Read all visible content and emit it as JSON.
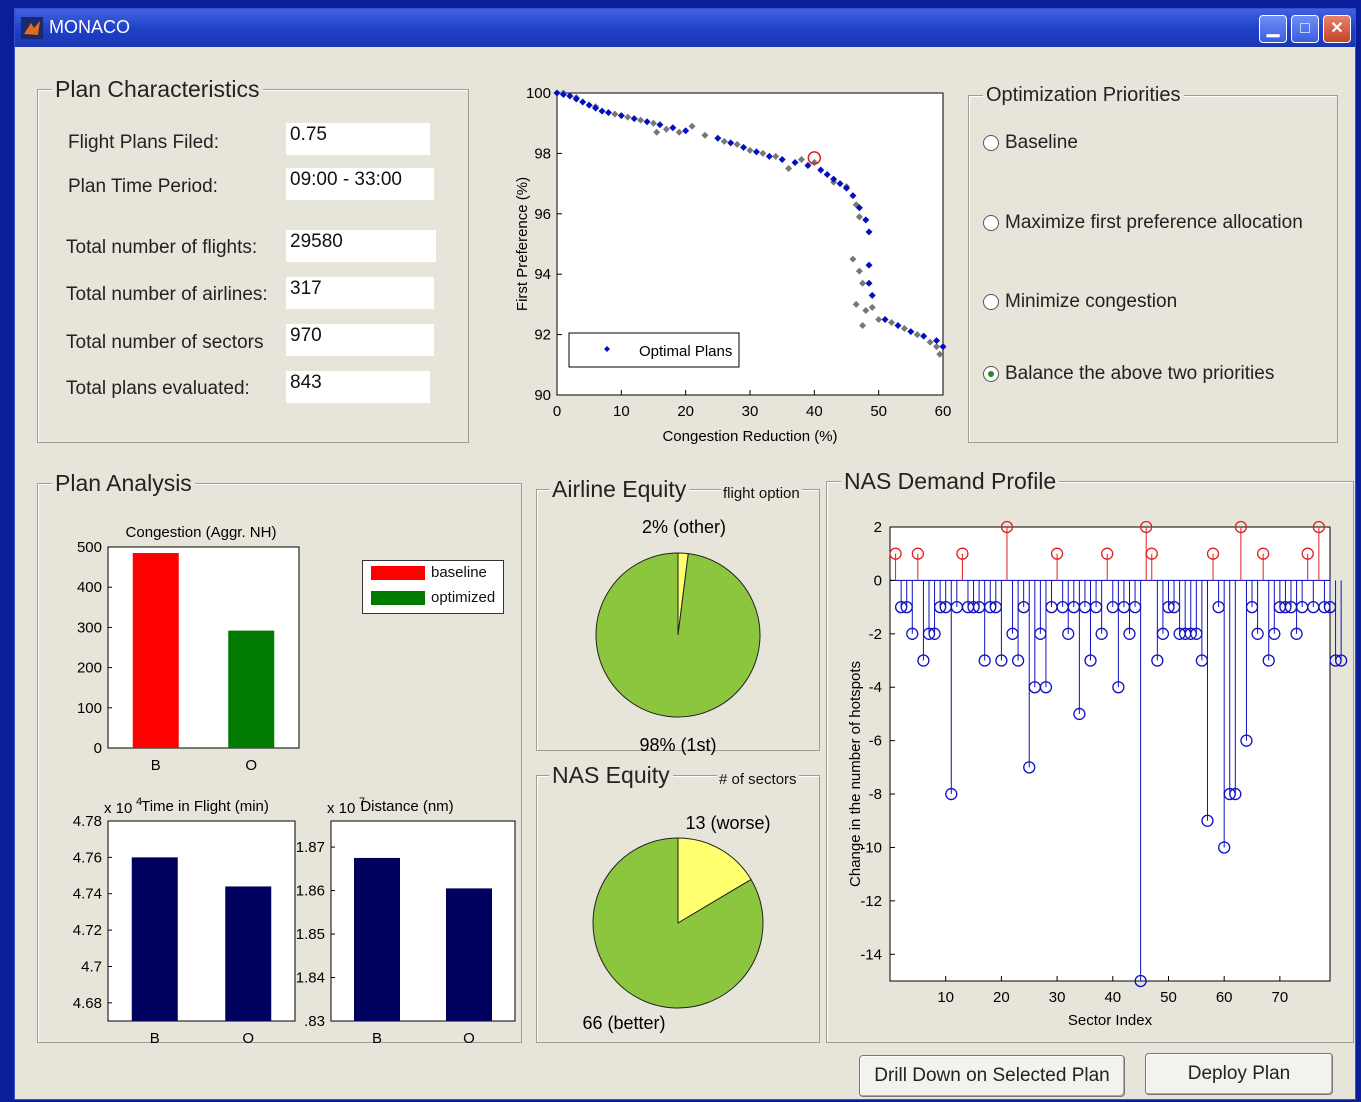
{
  "window": {
    "title": "MONACO",
    "controls": [
      "minimize",
      "maximize",
      "close"
    ]
  },
  "plan_characteristics": {
    "title": "Plan Characteristics",
    "fields": [
      {
        "label": "Flight Plans Filed:",
        "value": "0.75"
      },
      {
        "label": "Plan Time Period:",
        "value": "09:00 - 33:00"
      },
      {
        "label": "Total number of flights:",
        "value": "29580"
      },
      {
        "label": "Total number of airlines:",
        "value": "317"
      },
      {
        "label": "Total number of sectors",
        "value": "970"
      },
      {
        "label": "Total plans evaluated:",
        "value": "843"
      }
    ]
  },
  "optimization": {
    "title": "Optimization Priorities",
    "options": [
      {
        "label": "Baseline",
        "selected": false
      },
      {
        "label": "Maximize first preference allocation",
        "selected": false
      },
      {
        "label": "Minimize congestion",
        "selected": false
      },
      {
        "label": "Balance the above two priorities",
        "selected": true
      }
    ]
  },
  "plan_analysis": {
    "title": "Plan Analysis",
    "legend": [
      "baseline",
      "optimized"
    ]
  },
  "airline_equity": {
    "title": "Airline Equity",
    "subtitle": "flight option"
  },
  "nas_equity": {
    "title": "NAS Equity",
    "subtitle": "# of sectors"
  },
  "nas_demand": {
    "title": "NAS Demand Profile"
  },
  "buttons": {
    "drill_down": "Drill Down on Selected Plan",
    "deploy": "Deploy Plan"
  },
  "colors": {
    "baseline": "#ff0000",
    "optimized": "#007a00",
    "navy": "#00005e",
    "pie_green": "#8cc63f",
    "pie_yellow": "#ffff70"
  },
  "chart_data": [
    {
      "id": "pareto",
      "type": "scatter",
      "xlabel": "Congestion Reduction (%)",
      "ylabel": "First Preference (%)",
      "xlim": [
        0,
        60
      ],
      "ylim": [
        90,
        100
      ],
      "xticks": [
        0,
        10,
        20,
        30,
        40,
        50,
        60
      ],
      "yticks": [
        90,
        92,
        94,
        96,
        98,
        100
      ],
      "legend": "Optimal Plans",
      "legend_position": "bottom-left",
      "selected_point": [
        40,
        97.85
      ],
      "series": [
        {
          "name": "Optimal Plans",
          "color": "#0010c0",
          "points": [
            [
              0,
              100
            ],
            [
              1,
              99.95
            ],
            [
              2,
              99.9
            ],
            [
              3,
              99.8
            ],
            [
              4,
              99.7
            ],
            [
              5,
              99.6
            ],
            [
              6,
              99.5
            ],
            [
              7,
              99.4
            ],
            [
              8,
              99.35
            ],
            [
              10,
              99.25
            ],
            [
              12,
              99.15
            ],
            [
              14,
              99.05
            ],
            [
              16,
              98.95
            ],
            [
              18,
              98.85
            ],
            [
              20,
              98.75
            ],
            [
              25,
              98.5
            ],
            [
              27,
              98.35
            ],
            [
              29,
              98.2
            ],
            [
              31,
              98.05
            ],
            [
              33,
              97.9
            ],
            [
              35,
              97.8
            ],
            [
              37,
              97.7
            ],
            [
              39,
              97.6
            ],
            [
              41,
              97.45
            ],
            [
              42,
              97.3
            ],
            [
              43,
              97.15
            ],
            [
              44,
              97
            ],
            [
              45,
              96.85
            ],
            [
              46,
              96.6
            ],
            [
              47,
              96.2
            ],
            [
              48,
              95.8
            ],
            [
              48.5,
              95.4
            ],
            [
              48.5,
              94.3
            ],
            [
              48.5,
              93.7
            ],
            [
              49,
              93.3
            ],
            [
              51,
              92.5
            ],
            [
              53,
              92.3
            ],
            [
              55,
              92.1
            ],
            [
              57,
              91.95
            ],
            [
              59,
              91.8
            ],
            [
              60,
              91.6
            ]
          ]
        },
        {
          "name": "",
          "color": "#777777",
          "points": [
            [
              1,
              100
            ],
            [
              3,
              99.85
            ],
            [
              6,
              99.55
            ],
            [
              9,
              99.3
            ],
            [
              11,
              99.2
            ],
            [
              13,
              99.1
            ],
            [
              15,
              99
            ],
            [
              15.5,
              98.7
            ],
            [
              17,
              98.8
            ],
            [
              19,
              98.7
            ],
            [
              21,
              98.9
            ],
            [
              23,
              98.6
            ],
            [
              26,
              98.4
            ],
            [
              28,
              98.3
            ],
            [
              30,
              98.1
            ],
            [
              32,
              98
            ],
            [
              34,
              97.9
            ],
            [
              36,
              97.5
            ],
            [
              38,
              97.8
            ],
            [
              40,
              97.7
            ],
            [
              43,
              97.05
            ],
            [
              45,
              96.9
            ],
            [
              46.5,
              96.3
            ],
            [
              47,
              95.9
            ],
            [
              46,
              94.5
            ],
            [
              47,
              94.1
            ],
            [
              47.5,
              93.7
            ],
            [
              46.5,
              93
            ],
            [
              48,
              92.8
            ],
            [
              47.5,
              92.3
            ],
            [
              49,
              92.9
            ],
            [
              50,
              92.5
            ],
            [
              52,
              92.4
            ],
            [
              54,
              92.2
            ],
            [
              56,
              92
            ],
            [
              58,
              91.75
            ],
            [
              59,
              91.6
            ],
            [
              59.5,
              91.35
            ]
          ]
        }
      ]
    },
    {
      "id": "congestion",
      "type": "bar",
      "title": "Congestion (Aggr. NH)",
      "categories": [
        "B",
        "O"
      ],
      "values": [
        485,
        292
      ],
      "ylim": [
        0,
        500
      ],
      "yticks": [
        0,
        100,
        200,
        300,
        400,
        500
      ],
      "colors": [
        "#ff0000",
        "#007a00"
      ]
    },
    {
      "id": "time_in_flight",
      "type": "bar",
      "title": "Time in Flight (min)",
      "multiplier": "x 10",
      "exponent": "4",
      "categories": [
        "B",
        "O"
      ],
      "values": [
        4.76,
        4.744
      ],
      "ylim": [
        4.67,
        4.78
      ],
      "yticks": [
        4.68,
        4.7,
        4.72,
        4.74,
        4.76,
        4.78
      ],
      "ytick_labels": [
        "4.68",
        "4.7",
        "4.72",
        "4.74",
        "4.76",
        "4.78"
      ]
    },
    {
      "id": "distance",
      "type": "bar",
      "title": "Distance (nm)",
      "multiplier": "x 10",
      "exponent": "7",
      "categories": [
        "B",
        "O"
      ],
      "values": [
        1.8675,
        1.8605
      ],
      "ylim": [
        1.83,
        1.876
      ],
      "yticks": [
        1.83,
        1.84,
        1.85,
        1.86,
        1.87
      ],
      "ytick_labels": [
        ".83",
        "1.84",
        "1.85",
        "1.86",
        "1.87"
      ]
    },
    {
      "id": "airline_pie",
      "type": "pie",
      "slices": [
        {
          "label": "2% (other)",
          "value": 2,
          "color": "#ffff70"
        },
        {
          "label": "98% (1st)",
          "value": 98,
          "color": "#8cc63f"
        }
      ]
    },
    {
      "id": "nas_pie",
      "type": "pie",
      "slices": [
        {
          "label": "13 (worse)",
          "value": 13,
          "color": "#ffff70"
        },
        {
          "label": "66 (better)",
          "value": 66,
          "color": "#8cc63f"
        }
      ]
    },
    {
      "id": "demand",
      "type": "stem",
      "xlabel": "Sector Index",
      "ylabel": "Change in the number of hotspots",
      "xlim": [
        0,
        79
      ],
      "ylim": [
        -15,
        2
      ],
      "xticks": [
        10,
        20,
        30,
        40,
        50,
        60,
        70
      ],
      "yticks": [
        2,
        0,
        -2,
        -4,
        -6,
        -8,
        -10,
        -12,
        -14
      ],
      "values": [
        1,
        -1,
        -1,
        -2,
        1,
        -3,
        -2,
        -2,
        -1,
        -1,
        -8,
        -1,
        1,
        -1,
        -1,
        -1,
        -3,
        -1,
        -1,
        -3,
        2,
        -2,
        -3,
        -1,
        -7,
        -4,
        -2,
        -4,
        -1,
        1,
        -1,
        -2,
        -1,
        -5,
        -1,
        -3,
        -1,
        -2,
        1,
        -1,
        -4,
        -1,
        -2,
        -1,
        -15,
        2,
        1,
        -3,
        -2,
        -1,
        -1,
        -2,
        -2,
        -2,
        -2,
        -3,
        -9,
        1,
        -1,
        -10,
        -8,
        -8,
        2,
        -6,
        -1,
        -2,
        1,
        -3,
        -2,
        -1,
        -1,
        -1,
        -2,
        -1,
        1,
        -1,
        2,
        -1,
        -1,
        -3,
        -3
      ]
    }
  ]
}
